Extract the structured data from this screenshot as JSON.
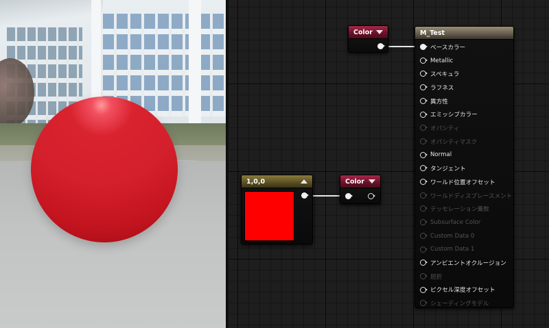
{
  "viewport": {
    "sphere_color": "#d41f2c"
  },
  "graph": {
    "color_node_1": {
      "title": "Color",
      "header_color": "#6e1129"
    },
    "color_node_2": {
      "title": "Color",
      "header_color": "#6e1129"
    },
    "constant_node": {
      "title": "1,0,0",
      "swatch_color": "#ff0000",
      "header_color": "#5d5224"
    },
    "material_node": {
      "title": "M_Test",
      "header_color": "#6c6353",
      "inputs": [
        {
          "label": "ベースカラー",
          "connected": true,
          "enabled": true
        },
        {
          "label": "Metallic",
          "connected": false,
          "enabled": true
        },
        {
          "label": "スペキュラ",
          "connected": false,
          "enabled": true
        },
        {
          "label": "ラフネス",
          "connected": false,
          "enabled": true
        },
        {
          "label": "異方性",
          "connected": false,
          "enabled": true
        },
        {
          "label": "エミッシブカラー",
          "connected": false,
          "enabled": true
        },
        {
          "label": "オパシティ",
          "connected": false,
          "enabled": false
        },
        {
          "label": "オパシティマスク",
          "connected": false,
          "enabled": false
        },
        {
          "label": "Normal",
          "connected": false,
          "enabled": true
        },
        {
          "label": "タンジェント",
          "connected": false,
          "enabled": true
        },
        {
          "label": "ワールド位置オフセット",
          "connected": false,
          "enabled": true
        },
        {
          "label": "ワールドディスプレースメント",
          "connected": false,
          "enabled": false
        },
        {
          "label": "テッセレーション乗数",
          "connected": false,
          "enabled": false
        },
        {
          "label": "Subsurface Color",
          "connected": false,
          "enabled": false
        },
        {
          "label": "Custom Data 0",
          "connected": false,
          "enabled": false
        },
        {
          "label": "Custom Data 1",
          "connected": false,
          "enabled": false
        },
        {
          "label": "アンビエントオクルージョン",
          "connected": false,
          "enabled": true
        },
        {
          "label": "屈折",
          "connected": false,
          "enabled": false
        },
        {
          "label": "ピクセル深度オフセット",
          "connected": false,
          "enabled": true
        },
        {
          "label": "シェーディングモデル",
          "connected": false,
          "enabled": false
        }
      ]
    }
  }
}
